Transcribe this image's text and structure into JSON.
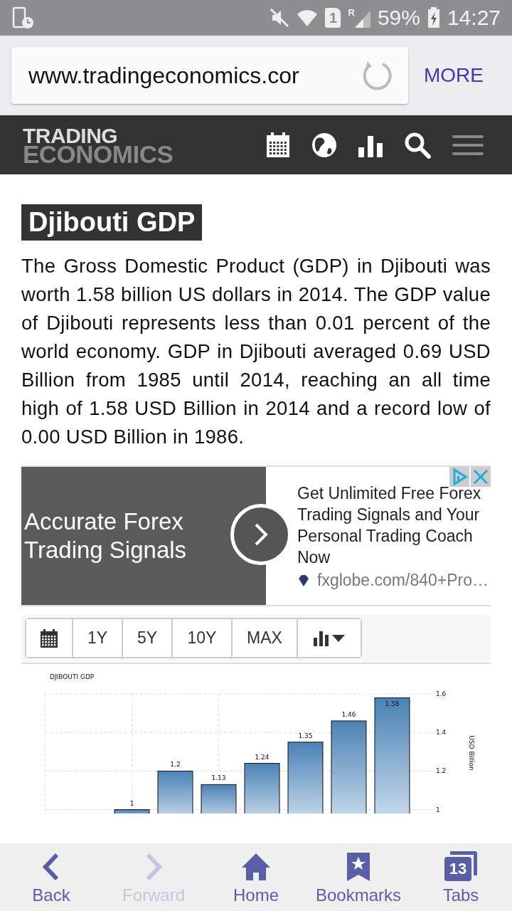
{
  "status_bar": {
    "sim": "1",
    "roaming": "R",
    "battery": "59%",
    "time": "14:27"
  },
  "address_bar": {
    "url": "www.tradingeconomics.cor",
    "more": "MORE"
  },
  "site_header": {
    "logo_top": "TRADING",
    "logo_bottom": "ECONOMICS"
  },
  "article": {
    "title": "Djibouti GDP",
    "text": "The Gross Domestic Product (GDP) in Djibouti was worth 1.58 billion US dollars in 2014. The GDP value of Djibouti represents less than 0.01 percent of the world economy. GDP in Djibouti averaged 0.69 USD Billion from 1985 until 2014, reaching an all time high of 1.58 USD Billion in 2014 and a record low of 0.00 USD Billion in 1986."
  },
  "ad": {
    "headline": "Accurate Forex Trading Signals",
    "body": "Get Unlimited Free Forex Trading Signals and Your Personal Trading Coach Now",
    "source": "fxglobe.com/840+Pro…"
  },
  "chart_toolbar": {
    "ranges": [
      "1Y",
      "5Y",
      "10Y",
      "MAX"
    ]
  },
  "chart": {
    "chart_data": {
      "type": "bar",
      "title": "DJIBOUTI GDP",
      "ylabel": "USD Billion",
      "values": [
        null,
        1,
        1.2,
        1.13,
        1.24,
        1.35,
        1.46,
        1.58
      ],
      "ylim": [
        0.98,
        1.6
      ],
      "yticks": [
        1,
        1.2,
        1.4,
        1.6
      ],
      "data_labels": true,
      "grid": true
    }
  },
  "bottom_nav": [
    {
      "kind": "back",
      "label": "Back",
      "disabled": false
    },
    {
      "kind": "forward",
      "label": "Forward",
      "disabled": true
    },
    {
      "kind": "home",
      "label": "Home",
      "disabled": false
    },
    {
      "kind": "bookmarks",
      "label": "Bookmarks",
      "disabled": false
    },
    {
      "kind": "tabs",
      "label": "Tabs",
      "count": "13",
      "disabled": false
    }
  ]
}
